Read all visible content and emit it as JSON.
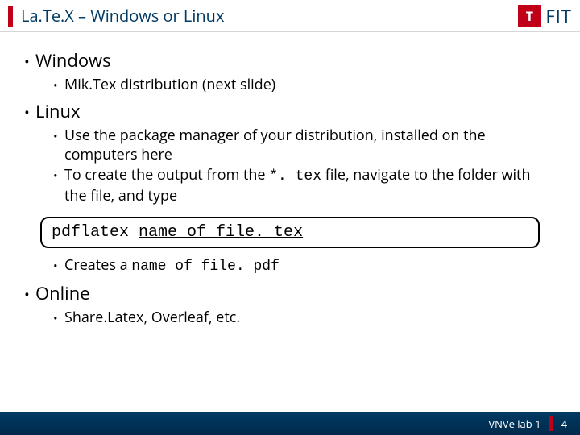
{
  "header": {
    "title": "La.Te.X – Windows or Linux",
    "logo_letter": "T",
    "logo_text": "FIT"
  },
  "bullets": {
    "windows": {
      "label": "Windows",
      "sub1": "Mik.Tex distribution (next slide)"
    },
    "linux": {
      "label": "Linux",
      "sub1": "Use the package manager of your distribution, installed on the computers here",
      "sub2a": "To create the output from the ",
      "sub2b": "*. tex",
      "sub2c": " file, navigate to the folder with the file, and type",
      "sub3a": "Creates a ",
      "sub3b": "name_of_file. pdf"
    },
    "online": {
      "label": "Online",
      "sub1": "Share.Latex, Overleaf, etc."
    }
  },
  "code": {
    "cmd": "pdflatex ",
    "arg": "name_of_file. tex"
  },
  "footer": {
    "label": "VNVe lab 1",
    "page": "4"
  }
}
